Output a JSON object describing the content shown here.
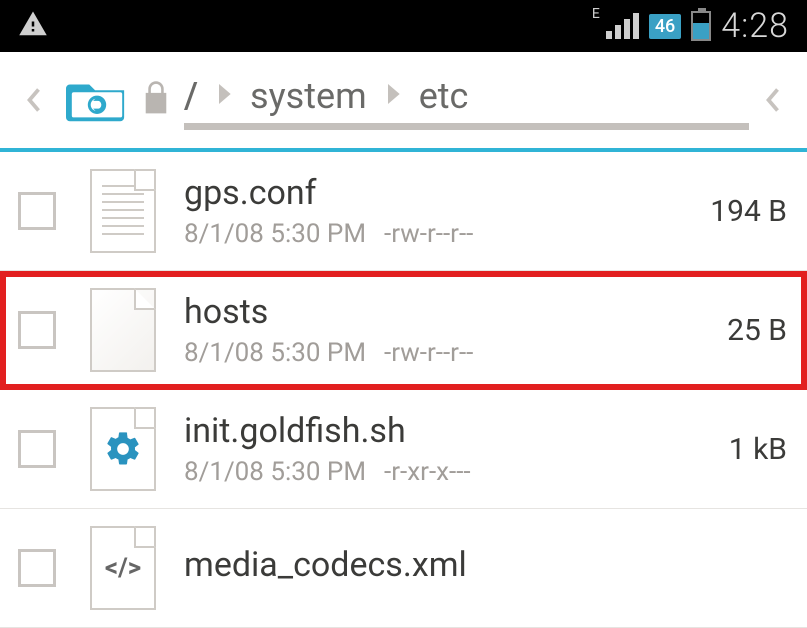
{
  "status": {
    "network_type": "E",
    "net_label": "46",
    "time": "4:28"
  },
  "breadcrumb": {
    "root": "/",
    "segments": [
      "system",
      "etc"
    ]
  },
  "files": [
    {
      "name": "gps.conf",
      "date": "8/1/08 5:30 PM",
      "perms": "-rw-r--r--",
      "size": "194 B",
      "icon": "lined",
      "highlighted": false
    },
    {
      "name": "hosts",
      "date": "8/1/08 5:30 PM",
      "perms": "-rw-r--r--",
      "size": "25 B",
      "icon": "blank",
      "highlighted": true
    },
    {
      "name": "init.goldfish.sh",
      "date": "8/1/08 5:30 PM",
      "perms": "-r-xr-x---",
      "size": "1 kB",
      "icon": "gear",
      "highlighted": false
    },
    {
      "name": "media_codecs.xml",
      "date": "",
      "perms": "",
      "size": "",
      "icon": "code",
      "highlighted": false
    }
  ]
}
